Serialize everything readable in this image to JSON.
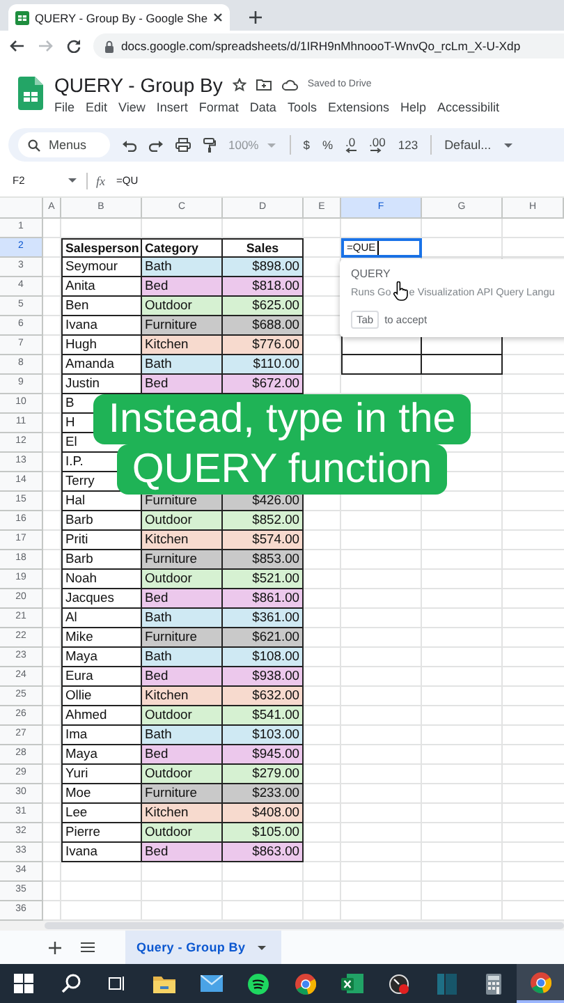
{
  "browser": {
    "tab_title": "QUERY - Group By - Google She",
    "url": "docs.google.com/spreadsheets/d/1IRH9nMhnoooT-WnvQo_rcLm_X-U-Xdp"
  },
  "document": {
    "title": "QUERY - Group By",
    "save_status": "Saved to Drive"
  },
  "menu": [
    "File",
    "Edit",
    "View",
    "Insert",
    "Format",
    "Data",
    "Tools",
    "Extensions",
    "Help",
    "Accessibilit"
  ],
  "toolbar": {
    "search_placeholder": "Menus",
    "zoom": "100%",
    "zoom_disabled": true,
    "currency": "$",
    "percent": "%",
    "decrease_decimals": ".0",
    "increase_decimals": ".00",
    "number_format": "123",
    "font": "Defaul..."
  },
  "formula_bar": {
    "cell": "F2",
    "label": "fx",
    "formula": "=QU"
  },
  "column_headers": [
    {
      "label": "A",
      "selected": false
    },
    {
      "label": "B",
      "selected": false
    },
    {
      "label": "C",
      "selected": false
    },
    {
      "label": "D",
      "selected": false
    },
    {
      "label": "E",
      "selected": false
    },
    {
      "label": "F",
      "selected": true
    },
    {
      "label": "G",
      "selected": false
    },
    {
      "label": "H",
      "selected": false
    }
  ],
  "row_headers": [
    {
      "label": "1",
      "selected": false
    },
    {
      "label": "2",
      "selected": true
    },
    {
      "label": "3",
      "selected": false
    },
    {
      "label": "4",
      "selected": false
    },
    {
      "label": "5",
      "selected": false
    },
    {
      "label": "6",
      "selected": false
    },
    {
      "label": "7",
      "selected": false
    },
    {
      "label": "8",
      "selected": false
    },
    {
      "label": "9",
      "selected": false
    },
    {
      "label": "10",
      "selected": false
    },
    {
      "label": "11",
      "selected": false
    },
    {
      "label": "12",
      "selected": false
    },
    {
      "label": "13",
      "selected": false
    },
    {
      "label": "14",
      "selected": false
    },
    {
      "label": "15",
      "selected": false
    },
    {
      "label": "16",
      "selected": false
    },
    {
      "label": "17",
      "selected": false
    },
    {
      "label": "18",
      "selected": false
    },
    {
      "label": "19",
      "selected": false
    },
    {
      "label": "20",
      "selected": false
    },
    {
      "label": "21",
      "selected": false
    },
    {
      "label": "22",
      "selected": false
    },
    {
      "label": "23",
      "selected": false
    },
    {
      "label": "24",
      "selected": false
    },
    {
      "label": "25",
      "selected": false
    },
    {
      "label": "26",
      "selected": false
    },
    {
      "label": "27",
      "selected": false
    },
    {
      "label": "28",
      "selected": false
    },
    {
      "label": "29",
      "selected": false
    },
    {
      "label": "30",
      "selected": false
    },
    {
      "label": "31",
      "selected": false
    },
    {
      "label": "32",
      "selected": false
    },
    {
      "label": "33",
      "selected": false
    },
    {
      "label": "34",
      "selected": false
    },
    {
      "label": "35",
      "selected": false
    },
    {
      "label": "36",
      "selected": false
    }
  ],
  "table": {
    "columns": [
      "Salesperson",
      "Category",
      "Sales"
    ],
    "rows": [
      {
        "salesperson": "Seymour",
        "category": "Bath",
        "sales": "$898.00",
        "color": "#cfe9f3"
      },
      {
        "salesperson": "Anita",
        "category": "Bed",
        "sales": "$818.00",
        "color": "#ecc8ec"
      },
      {
        "salesperson": "Ben",
        "category": "Outdoor",
        "sales": "$625.00",
        "color": "#d6f1d2"
      },
      {
        "salesperson": "Ivana",
        "category": "Furniture",
        "sales": "$688.00",
        "color": "#c9c9c9"
      },
      {
        "salesperson": "Hugh",
        "category": "Kitchen",
        "sales": "$776.00",
        "color": "#f7dace"
      },
      {
        "salesperson": "Amanda",
        "category": "Bath",
        "sales": "$110.00",
        "color": "#cfe9f3"
      },
      {
        "salesperson": "Justin",
        "category": "Bed",
        "sales": "$672.00",
        "color": "#ecc8ec"
      },
      {
        "salesperson": "B"
      },
      {
        "salesperson": "H"
      },
      {
        "salesperson": "El"
      },
      {
        "salesperson": "I.P."
      },
      {
        "salesperson": "Terry"
      },
      {
        "salesperson": "Hal",
        "category": "Furniture",
        "sales": "$426.00",
        "color": "#c9c9c9"
      },
      {
        "salesperson": "Barb",
        "category": "Outdoor",
        "sales": "$852.00",
        "color": "#d6f1d2"
      },
      {
        "salesperson": "Priti",
        "category": "Kitchen",
        "sales": "$574.00",
        "color": "#f7dace"
      },
      {
        "salesperson": "Barb",
        "category": "Furniture",
        "sales": "$853.00",
        "color": "#c9c9c9"
      },
      {
        "salesperson": "Noah",
        "category": "Outdoor",
        "sales": "$521.00",
        "color": "#d6f1d2"
      },
      {
        "salesperson": "Jacques",
        "category": "Bed",
        "sales": "$861.00",
        "color": "#ecc8ec"
      },
      {
        "salesperson": "Al",
        "category": "Bath",
        "sales": "$361.00",
        "color": "#cfe9f3"
      },
      {
        "salesperson": "Mike",
        "category": "Furniture",
        "sales": "$621.00",
        "color": "#c9c9c9"
      },
      {
        "salesperson": "Maya",
        "category": "Bath",
        "sales": "$108.00",
        "color": "#cfe9f3"
      },
      {
        "salesperson": "Eura",
        "category": "Bed",
        "sales": "$938.00",
        "color": "#ecc8ec"
      },
      {
        "salesperson": "Ollie",
        "category": "Kitchen",
        "sales": "$632.00",
        "color": "#f7dace"
      },
      {
        "salesperson": "Ahmed",
        "category": "Outdoor",
        "sales": "$541.00",
        "color": "#d6f1d2"
      },
      {
        "salesperson": "Ima",
        "category": "Bath",
        "sales": "$103.00",
        "color": "#cfe9f3"
      },
      {
        "salesperson": "Maya",
        "category": "Bed",
        "sales": "$945.00",
        "color": "#ecc8ec"
      },
      {
        "salesperson": "Yuri",
        "category": "Outdoor",
        "sales": "$279.00",
        "color": "#d6f1d2"
      },
      {
        "salesperson": "Moe",
        "category": "Furniture",
        "sales": "$233.00",
        "color": "#c9c9c9"
      },
      {
        "salesperson": "Lee",
        "category": "Kitchen",
        "sales": "$408.00",
        "color": "#f7dace"
      },
      {
        "salesperson": "Pierre",
        "category": "Outdoor",
        "sales": "$105.00",
        "color": "#d6f1d2"
      },
      {
        "salesperson": "Ivana",
        "category": "Bed",
        "sales": "$863.00",
        "color": "#ecc8ec"
      }
    ]
  },
  "editing_cell": {
    "value": "=QUE"
  },
  "autocomplete": {
    "function": "QUERY",
    "description": [
      "Runs Go",
      "e Visualization API Query Langu"
    ],
    "key": "Tab",
    "hint": "to accept"
  },
  "caption": [
    "Instead, type in the",
    "QUERY function"
  ],
  "sheet_tabs": [
    {
      "label": "Query - Group By",
      "selected": true
    }
  ],
  "taskbar": [
    {
      "kind": "start",
      "selected": false
    },
    {
      "kind": "search",
      "selected": false
    },
    {
      "kind": "taskview",
      "selected": false
    },
    {
      "kind": "folder",
      "selected": false
    },
    {
      "kind": "mail",
      "selected": false
    },
    {
      "kind": "music",
      "selected": false
    },
    {
      "kind": "browser",
      "selected": false
    },
    {
      "kind": "spreadsheet",
      "selected": false
    },
    {
      "kind": "gauge",
      "selected": false
    },
    {
      "kind": "panel",
      "selected": false
    },
    {
      "kind": "calculator",
      "selected": false
    },
    {
      "kind": "browser",
      "selected": true
    }
  ]
}
